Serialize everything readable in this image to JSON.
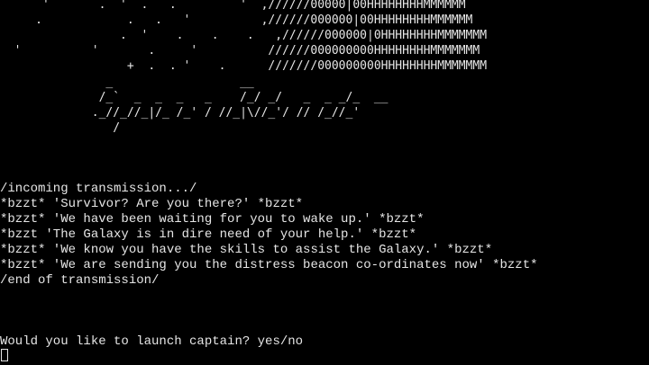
{
  "terminal": {
    "colors": {
      "background": "#000000",
      "foreground": "#e6e6e6"
    },
    "banner_art": {
      "stars": "      '       .  '  .   .         '  ,//////00000|00HHHHHHHHMMMMMM\n     .            .   .   '          ,//////000000|00HHHHHHHHMMMMMM\n                 .  '    .    .    .   ,//////000000|0HHHHHHHHMMMMMMM\n  '          '       .     '          //////000000000HHHHHHHHMMMMMMM\n                  +  .  . '    .      ///////000000000HHHHHHHHMMMMMMM",
      "logo": "               _                  __\n              /_`  _  _  _   _    /_/ _/   _  _ _/_  __\n             ._//_//_|/_ /_' / //_|\\//_'/ // /_//_'\n                /"
    },
    "transmission": {
      "header": "/incoming transmission.../",
      "messages": [
        "*bzzt* 'Survivor? Are you there?' *bzzt*",
        "*bzzt* 'We have been waiting for you to wake up.' *bzzt*",
        "*bzzt 'The Galaxy is in dire need of your help.' *bzzt*",
        "*bzzt* 'We know you have the skills to assist the Galaxy.' *bzzt*",
        "*bzzt* 'We are sending you the distress beacon co-ordinates now' *bzzt*"
      ],
      "footer": "/end of transmission/"
    },
    "prompt": {
      "question": "Would you like to launch captain? yes/no",
      "input_value": ""
    }
  }
}
